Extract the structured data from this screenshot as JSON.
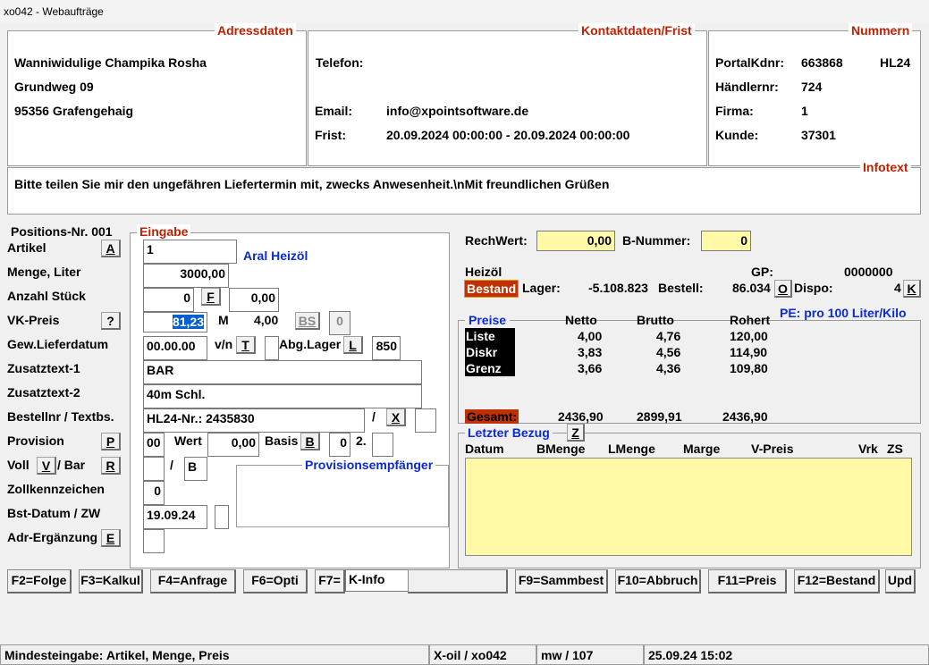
{
  "window": {
    "title": "xo042 - Webaufträge"
  },
  "address": {
    "legend": "Adressdaten",
    "name": "Wanniwidulige Champika Rosha",
    "street": "Grundweg 09",
    "city": "95356 Grafengehaig"
  },
  "contact": {
    "legend": "Kontaktdaten/Frist",
    "phone_label": "Telefon:",
    "phone_value": "",
    "email_label": "Email:",
    "email_value": "info@xpointsoftware.de",
    "deadline_label": "Frist:",
    "deadline_value": "20.09.2024 00:00:00  - 20.09.2024 00:00:00"
  },
  "numbers": {
    "legend": "Nummern",
    "portal_label": "PortalKdnr:",
    "portal_value": "663868",
    "portal_extra": "HL24",
    "dealer_label": "Händlernr:",
    "dealer_value": "724",
    "company_label": "Firma:",
    "company_value": "1",
    "customer_label": "Kunde:",
    "customer_value": "37301"
  },
  "infotext": {
    "legend": "Infotext",
    "text": "Bitte teilen Sie mir den ungefähren Liefertermin mit, zwecks Anwesenheit.\\nMit freundlichen Grüßen"
  },
  "position": {
    "label": "Positions-Nr. 001",
    "legend": "Eingabe",
    "rows": {
      "artikel": "Artikel",
      "menge": "Menge, Liter",
      "stueck": "Anzahl Stück",
      "vkpreis": "VK-Preis",
      "lieferdatum": "Gew.Lieferdatum",
      "zusatz1": "Zusatztext-1",
      "zusatz2": "Zusatztext-2",
      "bestellnr": "Bestellnr / Textbs.",
      "provision": "Provision",
      "voll": "Voll",
      "bar_sep": "/ Bar",
      "zoll": "Zollkennzeichen",
      "bstdatum": "Bst-Datum / ZW",
      "adr": "Adr-Ergänzung"
    },
    "buttons": {
      "a": "A",
      "q": "?",
      "f": "F",
      "bs": "BS",
      "t": "T",
      "l": "L",
      "x": "X",
      "p": "P",
      "b": "B",
      "v": "V",
      "r": "R",
      "e": "E"
    },
    "fields": {
      "artikel": "1",
      "artikel_name": "Aral Heizöl",
      "menge": "3000,00",
      "stueck": "0",
      "stueck2": "0,00",
      "vkpreis": "81,23",
      "m_label": "M",
      "m_value": "4,00",
      "bs_box": "0",
      "lieferdatum": "00.00.00",
      "vn_label": "v/n",
      "abglager_label": "Abg.Lager",
      "abglager_value": "850",
      "zusatz1": "BAR",
      "zusatz2": "40m Schl.",
      "bestellnr": "HL24-Nr.: 2435830",
      "slash": "/",
      "prov_value": "00",
      "wert_label": "Wert",
      "wert_value": "0,00",
      "basis_label": "Basis",
      "basis_value": "0",
      "two_label": "2.",
      "voll_slash": "/",
      "voll_value": "B",
      "zoll_value": "0",
      "bstdatum": "19.09.24",
      "prov_empf_legend": "Provisionsempfänger"
    }
  },
  "right": {
    "rechwert_label": "RechWert:",
    "rechwert_value": "0,00",
    "bnummer_label": "B-Nummer:",
    "bnummer_value": "0",
    "product": "Heizöl",
    "gp_label": "GP:",
    "gp_value": "0000000",
    "bestand_label": "Bestand",
    "lager_label": "Lager:",
    "lager_value": "-5.108.823",
    "bestell_label": "Bestell:",
    "bestell_value": "86.034",
    "o_btn": "O",
    "dispo_label": "Dispo:",
    "dispo_value": "4",
    "k_btn": "K",
    "prices": {
      "legend": "Preise",
      "pe_label": "PE:  pro 100 Liter/Kilo",
      "headers": [
        "Netto",
        "Brutto",
        "Rohert"
      ],
      "rows": [
        {
          "name": "Liste",
          "netto": "4,00",
          "brutto": "4,76",
          "rohert": "120,00"
        },
        {
          "name": "Diskr",
          "netto": "3,83",
          "brutto": "4,56",
          "rohert": "114,90"
        },
        {
          "name": "Grenz",
          "netto": "3,66",
          "brutto": "4,36",
          "rohert": "109,80"
        }
      ],
      "total_label": "Gesamt:",
      "total_netto": "2436,90",
      "total_brutto": "2899,91",
      "total_rohert": "2436,90"
    },
    "last": {
      "legend": "Letzter Bezug",
      "z_btn": "Z",
      "headers": [
        "Datum",
        "BMenge",
        "LMenge",
        "Marge",
        "V-Preis",
        "Vrk",
        "ZS"
      ]
    }
  },
  "fkeys": [
    "F2=Folge",
    "F3=Kalkul",
    "F4=Anfrage",
    "F6=Opti",
    "F7=",
    "K-Info",
    "",
    "F9=Sammbest",
    "F10=Abbruch",
    "F11=Preis",
    "F12=Bestand",
    "Upd"
  ],
  "statusbar": {
    "hint": "Mindesteingabe: Artikel, Menge, Preis",
    "app": "X-oil / xo042",
    "user": "mw / 107",
    "datetime": "25.09.24 15:02"
  }
}
